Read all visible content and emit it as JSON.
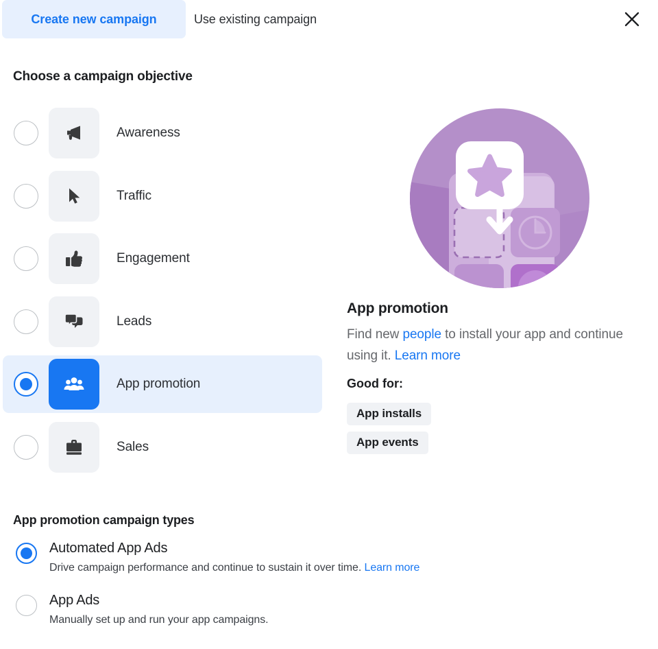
{
  "tabs": [
    {
      "id": "create-new-campaign",
      "label": "Create new campaign",
      "active": true
    },
    {
      "id": "use-existing-campaign",
      "label": "Use existing campaign",
      "active": false
    }
  ],
  "close_label": "Close",
  "objective_section": {
    "title": "Choose a campaign objective",
    "items": [
      {
        "label": "Awareness",
        "icon": "megaphone-icon",
        "selected": false
      },
      {
        "label": "Traffic",
        "icon": "cursor-icon",
        "selected": false
      },
      {
        "label": "Engagement",
        "icon": "thumbs-up-icon",
        "selected": false
      },
      {
        "label": "Leads",
        "icon": "speech-bubbles-icon",
        "selected": false
      },
      {
        "label": "App promotion",
        "icon": "people-group-icon",
        "selected": true
      },
      {
        "label": "Sales",
        "icon": "briefcase-icon",
        "selected": false
      }
    ]
  },
  "detail": {
    "illustration": "app-install-illustration",
    "title": "App promotion",
    "desc_part1": "Find new ",
    "desc_link1": "people",
    "desc_part2": " to install your app and continue using it. ",
    "desc_link2": "Learn more",
    "good_for_label": "Good for:",
    "tags": [
      "App installs",
      "App events"
    ]
  },
  "types_section": {
    "title": "App promotion campaign types",
    "items": [
      {
        "name": "Automated App Ads",
        "desc": "Drive campaign performance and continue to sustain it over time. ",
        "link": "Learn more",
        "selected": true
      },
      {
        "name": "App Ads",
        "desc": "Manually set up and run your app campaigns.",
        "link": "",
        "selected": false
      }
    ]
  },
  "colors": {
    "accent_blue": "#1877f2",
    "tab_active_bg": "#e7f0fe",
    "row_selected_bg": "#e7f0fd",
    "tile_bg": "#f0f2f5",
    "illustration_purple": "#b48fc9"
  }
}
